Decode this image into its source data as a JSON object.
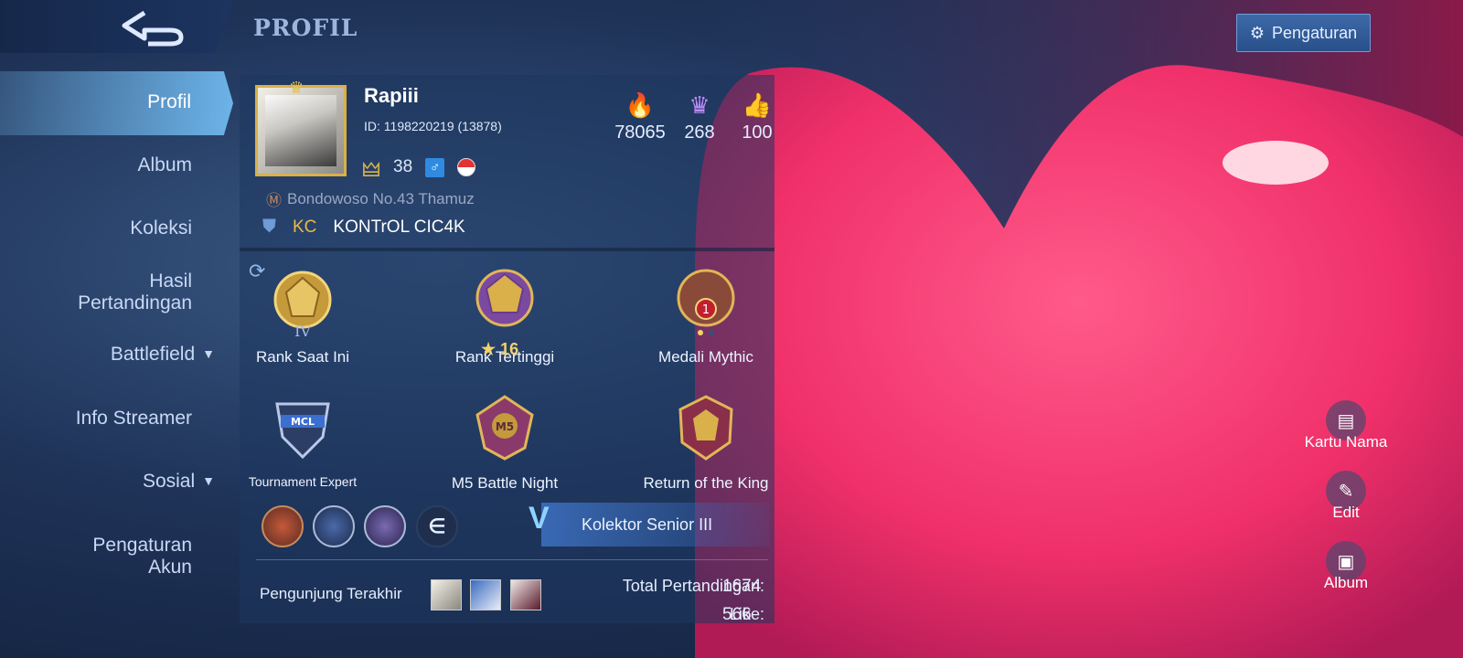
{
  "header": {
    "title": "PROFIL",
    "settings_label": "Pengaturan"
  },
  "sidebar": {
    "items": [
      {
        "label": "Profil"
      },
      {
        "label": "Album"
      },
      {
        "label": "Koleksi"
      },
      {
        "label": "Hasil Pertandingan"
      },
      {
        "label": "Battlefield"
      },
      {
        "label": "Info Streamer"
      },
      {
        "label": "Sosial"
      },
      {
        "label": "Pengaturan Akun"
      }
    ]
  },
  "profile": {
    "name": "Rapiii",
    "id_text": "ID:  1198220219 (13878)",
    "level": "38",
    "gender_symbol": "♂",
    "guild": "Bondowoso No.43 Thamuz",
    "squad_tag": "KC",
    "squad_name": "KONTrOL CIC4K",
    "stats": {
      "popularity": "78065",
      "charm": "268",
      "likes": "100"
    }
  },
  "badges": {
    "current_rank": {
      "label": "Rank Saat Ini",
      "tier": "IV"
    },
    "highest_rank": {
      "label": "Rank Tertinggi",
      "stars": "16"
    },
    "mythic_medal": {
      "label": "Medali Mythic",
      "emblem_number": "1"
    },
    "tournament": {
      "label": "Tournament Expert",
      "emblem_text": "MCL"
    },
    "m5": {
      "label": "M5 Battle Night",
      "emblem_text": "M5"
    },
    "king": {
      "label": "Return of the King"
    }
  },
  "collector": {
    "label": "Kolektor Senior III"
  },
  "visitors": {
    "label": "Pengunjung Terakhir"
  },
  "totals": {
    "matches_label": "Total Pertandingan:",
    "matches": "1674",
    "likes_label": "Like:",
    "likes": "566"
  },
  "actions": {
    "name_card": "Kartu Nama",
    "edit": "Edit",
    "album": "Album"
  },
  "colors": {
    "accent_gold": "#e8b94a",
    "panel": "#1e375f",
    "heart": "#ff2f6a"
  }
}
